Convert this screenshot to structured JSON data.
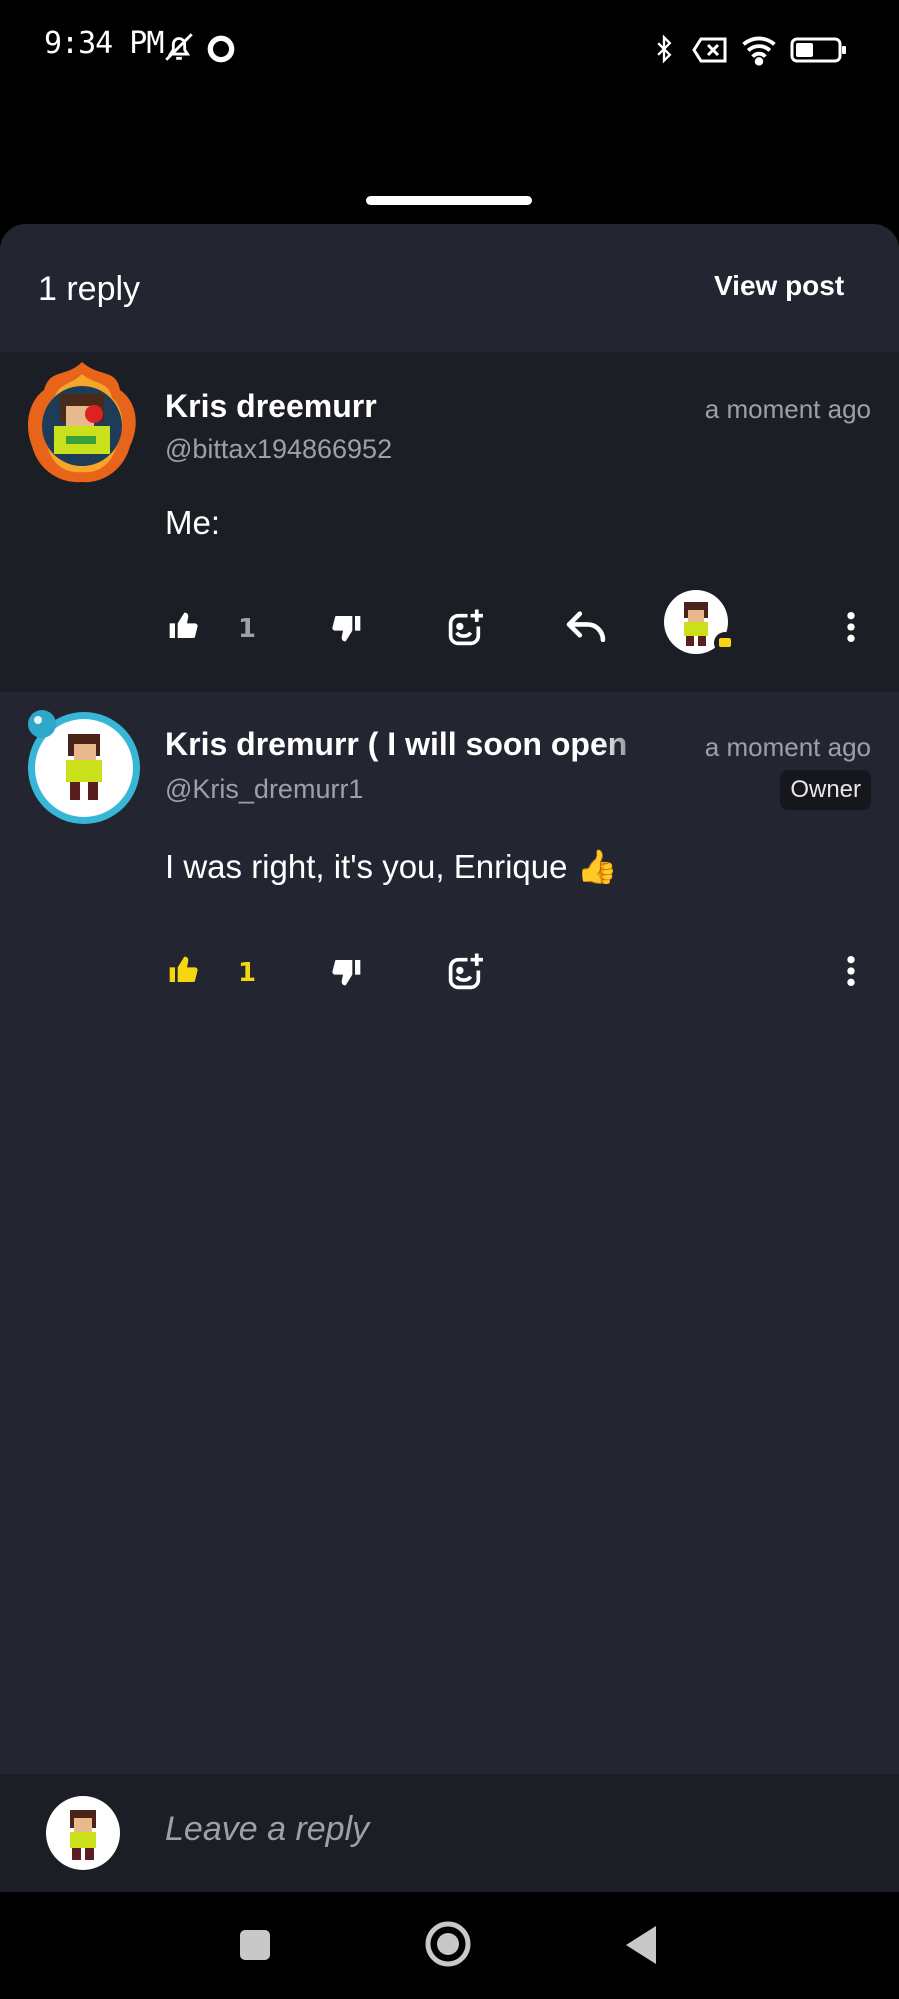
{
  "status_bar": {
    "time": "9:34 PM",
    "battery": "35"
  },
  "header": {
    "title": "1 reply",
    "view_post_label": "View post"
  },
  "comments": [
    {
      "author": "Kris dreemurr",
      "handle": "@bittax194866952",
      "time": "a moment ago",
      "text": "Me:",
      "likes": "1",
      "liked": false
    },
    {
      "author": "Kris dremurr ( I will soon open",
      "handle": "@Kris_dremurr1",
      "time": "a moment ago",
      "badge": "Owner",
      "text": "I was right, it's you, Enrique 👍",
      "likes": "1",
      "liked": true
    }
  ],
  "reply_bar": {
    "placeholder": "Leave a reply"
  },
  "colors": {
    "background": "#232631",
    "parent_bg": "#1c1e25",
    "accent_yellow": "#f5d60f",
    "muted_text": "#9da0a8"
  }
}
